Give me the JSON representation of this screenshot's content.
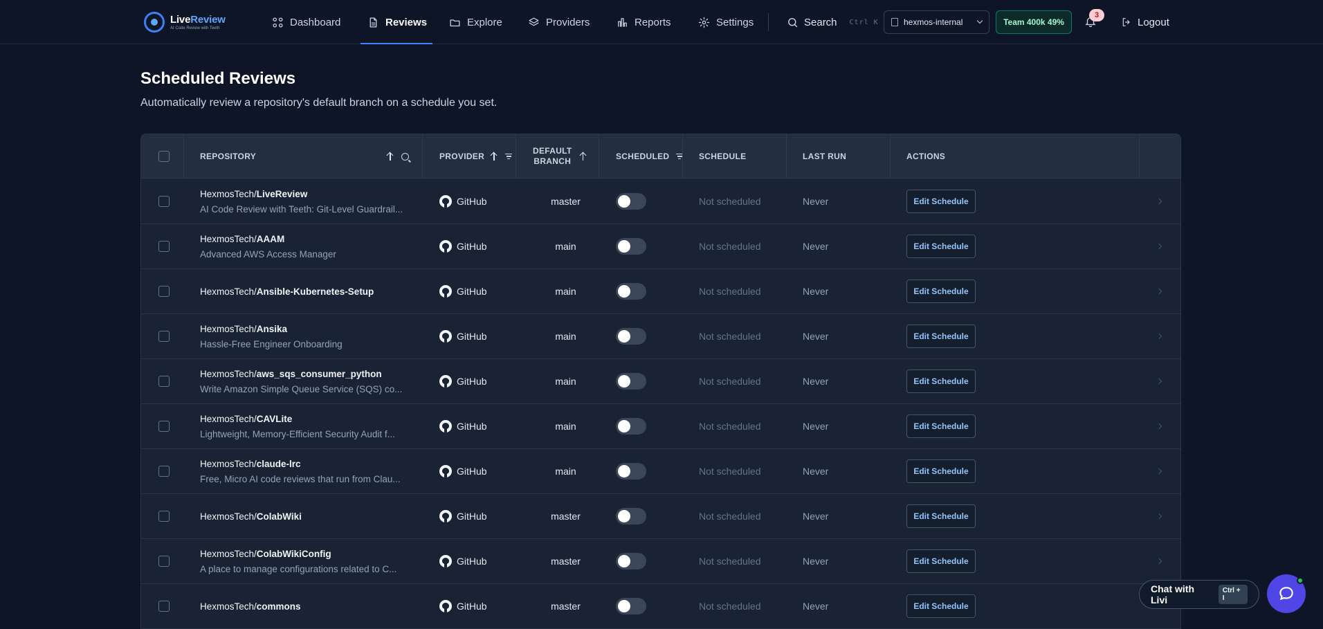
{
  "brand": {
    "title_part1": "Live",
    "title_part2": "Review",
    "tagline": "AI Code Review with Teeth"
  },
  "nav": [
    {
      "label": "Dashboard",
      "icon": "grid-icon"
    },
    {
      "label": "Reviews",
      "icon": "document-icon",
      "active": true
    },
    {
      "label": "Explore",
      "icon": "folder-icon"
    },
    {
      "label": "Providers",
      "icon": "layers-icon"
    },
    {
      "label": "Reports",
      "icon": "bar-chart-icon"
    },
    {
      "label": "Settings",
      "icon": "gear-icon"
    }
  ],
  "search": {
    "label": "Search",
    "shortcut": "Ctrl K"
  },
  "org": {
    "name": "hexmos-internal"
  },
  "plan": {
    "label": "Team 400k 49%"
  },
  "notifications": {
    "count": "3"
  },
  "logout": {
    "label": "Logout"
  },
  "page": {
    "title": "Scheduled Reviews",
    "subtitle": "Automatically review a repository's default branch on a schedule you set."
  },
  "table": {
    "headers": {
      "repository": "REPOSITORY",
      "provider": "PROVIDER",
      "branch_line1": "DEFAULT",
      "branch_line2": "BRANCH",
      "scheduled": "SCHEDULED",
      "schedule": "SCHEDULE",
      "last_run": "LAST RUN",
      "actions": "ACTIONS"
    },
    "action_label": "Edit Schedule",
    "rows": [
      {
        "org": "HexmosTech/",
        "repo": "LiveReview",
        "desc": "AI Code Review with Teeth: Git-Level Guardrail...",
        "provider": "GitHub",
        "branch": "master",
        "schedule": "Not scheduled",
        "last_run": "Never"
      },
      {
        "org": "HexmosTech/",
        "repo": "AAAM",
        "desc": "Advanced AWS Access Manager",
        "provider": "GitHub",
        "branch": "main",
        "schedule": "Not scheduled",
        "last_run": "Never"
      },
      {
        "org": "HexmosTech/",
        "repo": "Ansible-Kubernetes-Setup",
        "desc": "",
        "provider": "GitHub",
        "branch": "main",
        "schedule": "Not scheduled",
        "last_run": "Never"
      },
      {
        "org": "HexmosTech/",
        "repo": "Ansika",
        "desc": "Hassle-Free Engineer Onboarding",
        "provider": "GitHub",
        "branch": "main",
        "schedule": "Not scheduled",
        "last_run": "Never"
      },
      {
        "org": "HexmosTech/",
        "repo": "aws_sqs_consumer_python",
        "desc": "Write Amazon Simple Queue Service (SQS) co...",
        "provider": "GitHub",
        "branch": "main",
        "schedule": "Not scheduled",
        "last_run": "Never"
      },
      {
        "org": "HexmosTech/",
        "repo": "CAVLite",
        "desc": "Lightweight, Memory-Efficient Security Audit f...",
        "provider": "GitHub",
        "branch": "main",
        "schedule": "Not scheduled",
        "last_run": "Never"
      },
      {
        "org": "HexmosTech/",
        "repo": "claude-lrc",
        "desc": "Free, Micro AI code reviews that run from Clau...",
        "provider": "GitHub",
        "branch": "main",
        "schedule": "Not scheduled",
        "last_run": "Never"
      },
      {
        "org": "HexmosTech/",
        "repo": "ColabWiki",
        "desc": "",
        "provider": "GitHub",
        "branch": "master",
        "schedule": "Not scheduled",
        "last_run": "Never"
      },
      {
        "org": "HexmosTech/",
        "repo": "ColabWikiConfig",
        "desc": "A place to manage configurations related to C...",
        "provider": "GitHub",
        "branch": "master",
        "schedule": "Not scheduled",
        "last_run": "Never"
      },
      {
        "org": "HexmosTech/",
        "repo": "commons",
        "desc": "",
        "provider": "GitHub",
        "branch": "master",
        "schedule": "Not scheduled",
        "last_run": "Never"
      }
    ]
  },
  "chat": {
    "label": "Chat with Livi",
    "shortcut": "Ctrl + I"
  }
}
